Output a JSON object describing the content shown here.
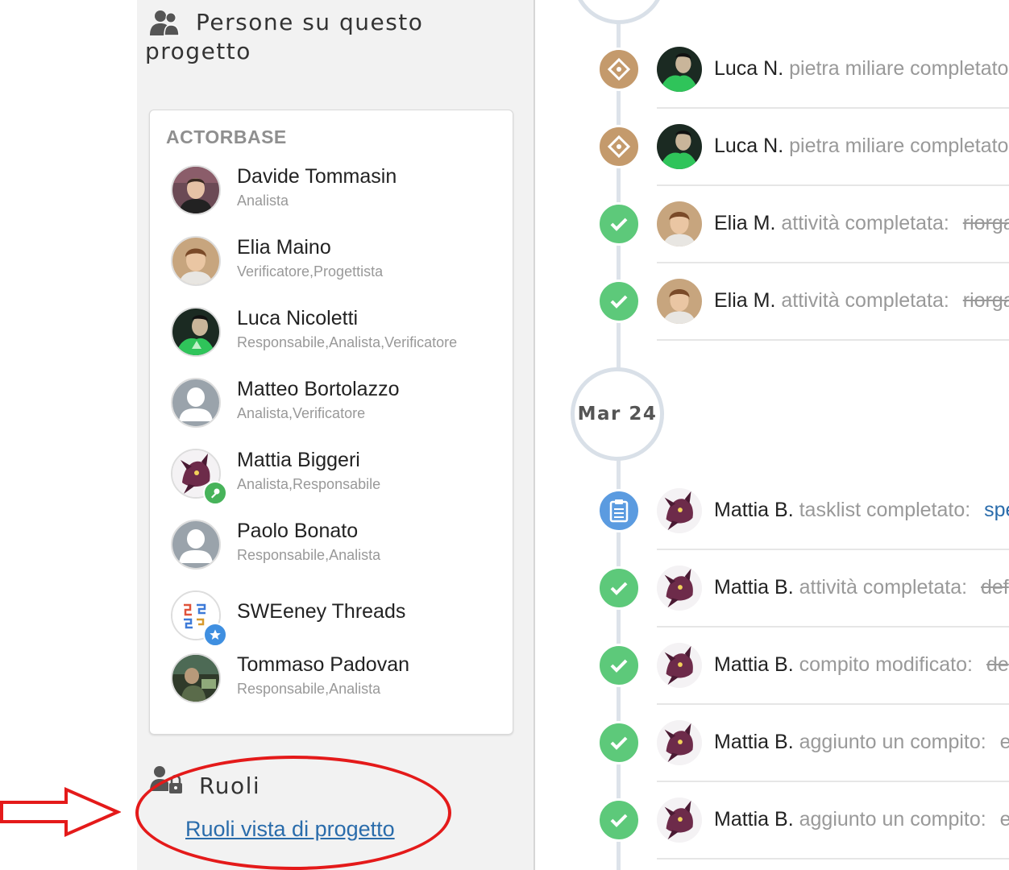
{
  "sidebar": {
    "people_title": "Persone su questo progetto",
    "company": "ACTORBASE",
    "people": [
      {
        "name": "Davide Tommasin",
        "role": "Analista"
      },
      {
        "name": "Elia Maino",
        "role": "Verificatore,Progettista"
      },
      {
        "name": "Luca Nicoletti",
        "role": "Responsabile,Analista,Verificatore"
      },
      {
        "name": "Matteo Bortolazzo",
        "role": "Analista,Verificatore"
      },
      {
        "name": "Mattia Biggeri",
        "role": "Analista,Responsabile"
      },
      {
        "name": "Paolo Bonato",
        "role": "Responsabile,Analista"
      },
      {
        "name": "SWEeney Threads",
        "role": ""
      },
      {
        "name": "Tommaso Padovan",
        "role": "Responsabile,Analista"
      }
    ],
    "roles_title": "Ruoli",
    "roles_link": "Ruoli vista di progetto"
  },
  "timeline": {
    "date": "Mar 24",
    "events": [
      {
        "who": "Luca N.",
        "action": "pietra miliare completato",
        "object": "",
        "icon": "milestone-icon"
      },
      {
        "who": "Luca N.",
        "action": "pietra miliare completato",
        "object": "",
        "icon": "milestone-icon"
      },
      {
        "who": "Elia M.",
        "action": "attività completata:",
        "object": "riorga",
        "icon": "check-icon"
      },
      {
        "who": "Elia M.",
        "action": "attività completata:",
        "object": "riorga",
        "icon": "check-icon"
      },
      {
        "who": "Mattia B.",
        "action": "tasklist completato:",
        "object": "spe",
        "icon": "clipboard-icon"
      },
      {
        "who": "Mattia B.",
        "action": "attività completata:",
        "object": "def",
        "icon": "check-icon"
      },
      {
        "who": "Mattia B.",
        "action": "compito modificato:",
        "object": "de",
        "icon": "check-icon"
      },
      {
        "who": "Mattia B.",
        "action": "aggiunto un compito:",
        "object": "e",
        "icon": "check-icon"
      },
      {
        "who": "Mattia B.",
        "action": "aggiunto un compito:",
        "object": "e",
        "icon": "check-icon"
      }
    ]
  },
  "colors": {
    "milestone": "#c49a6c",
    "check": "#5dc97a",
    "clipboard": "#5b9be0",
    "link": "#2a6cab",
    "annotation": "#e41a1a"
  }
}
